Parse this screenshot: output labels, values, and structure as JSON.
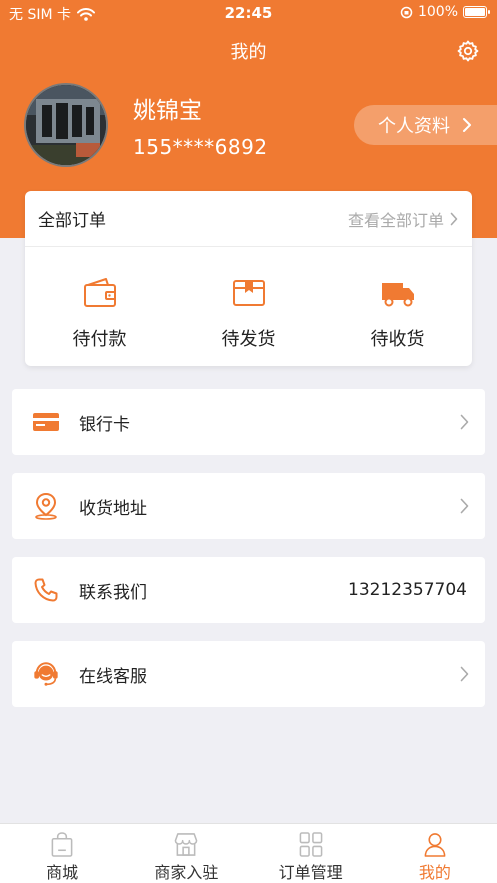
{
  "status_bar": {
    "carrier": "无 SIM 卡",
    "time": "22:45",
    "battery": "100%"
  },
  "nav": {
    "title": "我的"
  },
  "user": {
    "name": "姚锦宝",
    "phone": "155****6892",
    "profile_label": "个人资料"
  },
  "orders": {
    "title": "全部订单",
    "view_all": "查看全部订单",
    "items": [
      {
        "label": "待付款",
        "icon": "wallet-icon"
      },
      {
        "label": "待发货",
        "icon": "package-icon"
      },
      {
        "label": "待收货",
        "icon": "truck-icon"
      }
    ]
  },
  "menu": [
    {
      "label": "银行卡",
      "icon": "bank-card-icon"
    },
    {
      "label": "收货地址",
      "icon": "location-pin-icon"
    },
    {
      "label": "联系我们",
      "icon": "phone-icon",
      "value": "13212357704"
    },
    {
      "label": "在线客服",
      "icon": "headset-icon"
    }
  ],
  "tabs": [
    {
      "label": "商城",
      "icon": "shopping-bag-icon"
    },
    {
      "label": "商家入驻",
      "icon": "store-icon"
    },
    {
      "label": "订单管理",
      "icon": "grid-icon"
    },
    {
      "label": "我的",
      "icon": "person-icon",
      "active": true
    }
  ],
  "colors": {
    "accent": "#f07a32",
    "background": "#efeff4"
  }
}
